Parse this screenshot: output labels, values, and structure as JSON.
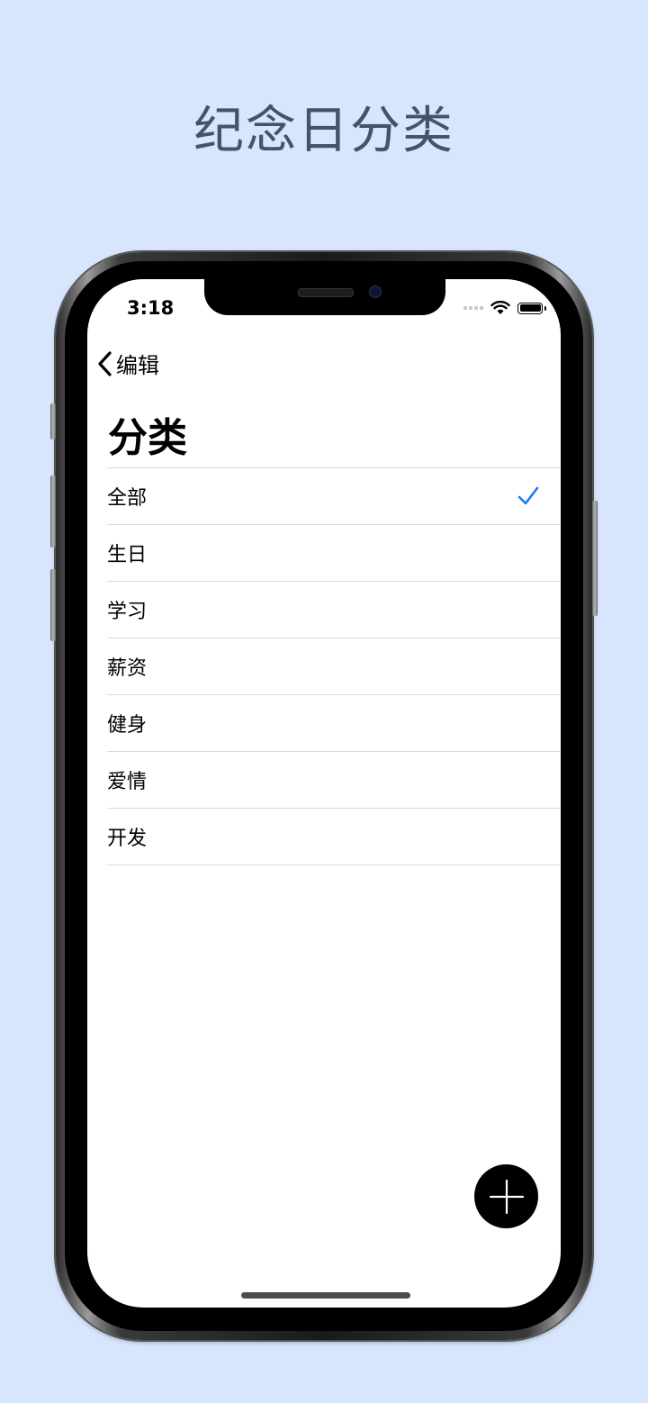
{
  "promo": {
    "title": "纪念日分类"
  },
  "status_bar": {
    "time": "3:18"
  },
  "nav": {
    "back_label": "编辑",
    "large_title": "分类"
  },
  "categories": [
    {
      "label": "全部",
      "selected": true
    },
    {
      "label": "生日",
      "selected": false
    },
    {
      "label": "学习",
      "selected": false
    },
    {
      "label": "薪资",
      "selected": false
    },
    {
      "label": "健身",
      "selected": false
    },
    {
      "label": "爱情",
      "selected": false
    },
    {
      "label": "开发",
      "selected": false
    }
  ],
  "icons": {
    "back": "chevron-left-icon",
    "check": "checkmark-icon",
    "add": "plus-icon",
    "wifi": "wifi-icon",
    "battery": "battery-icon",
    "signal": "cellular-signal-icon"
  },
  "colors": {
    "page_background": "#d7e6fd",
    "promo_title": "#44536b",
    "accent": "#1a7cf5",
    "fab": "#000000"
  }
}
